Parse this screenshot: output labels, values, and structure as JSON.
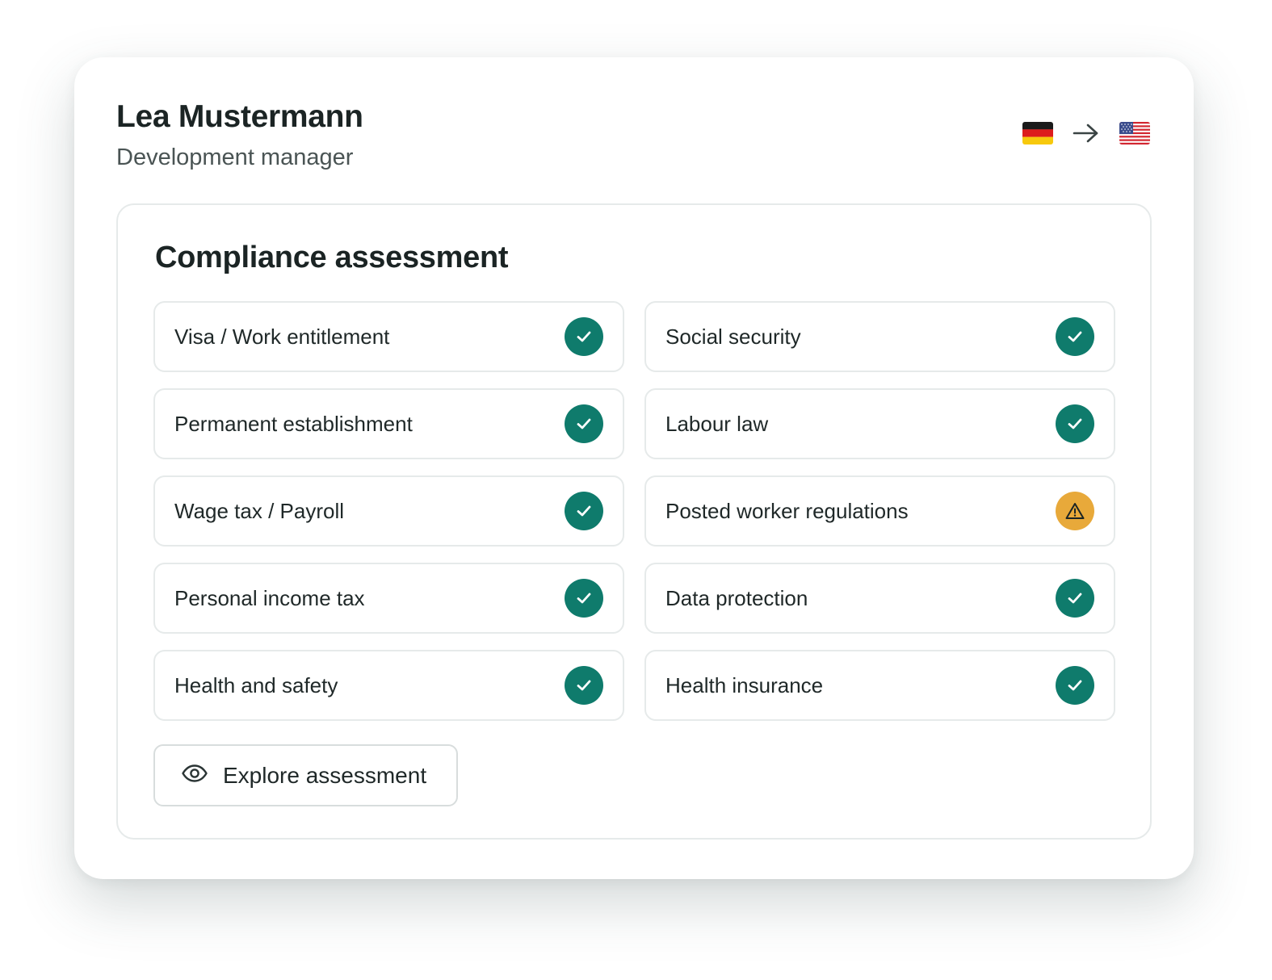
{
  "profile": {
    "name": "Lea Mustermann",
    "role": "Development manager",
    "route": {
      "from_flag": "germany-flag-icon",
      "arrow": "arrow-right-icon",
      "to_flag": "usa-flag-icon"
    }
  },
  "assessment": {
    "title": "Compliance assessment",
    "items": [
      {
        "label": "Visa / Work entitlement",
        "status": "ok"
      },
      {
        "label": "Social security",
        "status": "ok"
      },
      {
        "label": "Permanent establishment",
        "status": "ok"
      },
      {
        "label": "Labour law",
        "status": "ok"
      },
      {
        "label": "Wage tax / Payroll",
        "status": "ok"
      },
      {
        "label": "Posted worker regulations",
        "status": "warning"
      },
      {
        "label": "Personal income tax",
        "status": "ok"
      },
      {
        "label": "Data protection",
        "status": "ok"
      },
      {
        "label": "Health and safety",
        "status": "ok"
      },
      {
        "label": "Health insurance",
        "status": "ok"
      }
    ],
    "explore_label": "Explore assessment",
    "explore_icon": "eye-icon"
  },
  "colors": {
    "ok": "#0f7b6c",
    "warning": "#e8a93a",
    "text": "#1b2424",
    "muted": "#4a5454",
    "border": "#e6eaea"
  }
}
